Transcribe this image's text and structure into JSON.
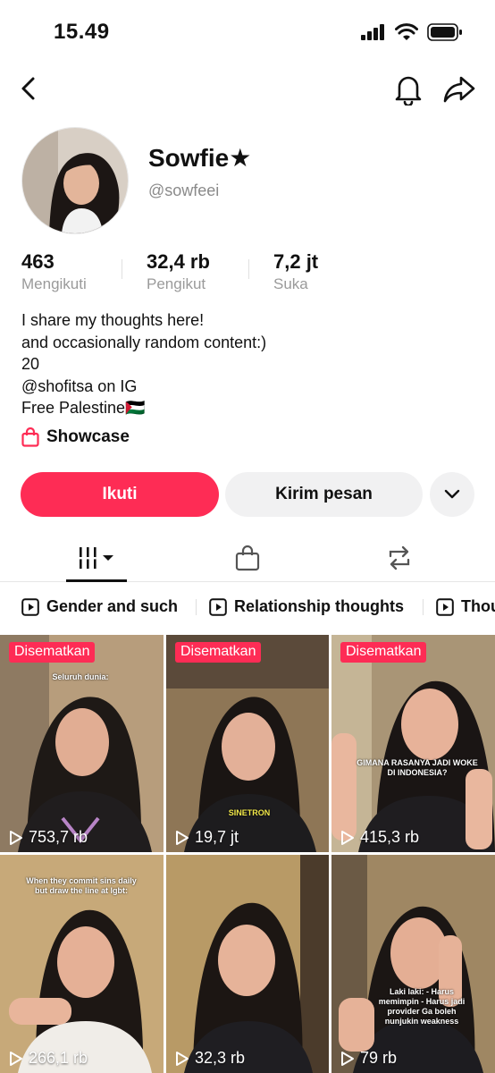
{
  "status_bar": {
    "time": "15.49"
  },
  "profile": {
    "name": "Sowfie★",
    "handle": "@sowfeei",
    "stats": [
      {
        "value": "463",
        "label": "Mengikuti"
      },
      {
        "value": "32,4 rb",
        "label": "Pengikut"
      },
      {
        "value": "7,2 jt",
        "label": "Suka"
      }
    ],
    "bio": [
      "I share my thoughts here!",
      "and occasionally random content:)",
      "20",
      "@shofitsa on IG",
      "Free Palestine🇵🇸"
    ],
    "showcase_label": "Showcase"
  },
  "actions": {
    "follow_label": "Ikuti",
    "message_label": "Kirim pesan"
  },
  "playlists": [
    "Gender and such",
    "Relationship thoughts",
    "Thou"
  ],
  "videos": [
    {
      "pinned_label": "Disematkan",
      "views": "753,7 rb",
      "caption": "Seluruh dunia:"
    },
    {
      "pinned_label": "Disematkan",
      "views": "19,7 jt",
      "caption": "SINETRON"
    },
    {
      "pinned_label": "Disematkan",
      "views": "415,3 rb",
      "caption": "GIMANA RASANYA JADI WOKE DI INDONESIA?"
    },
    {
      "pinned_label": "",
      "views": "266,1 rb",
      "caption": "When they commit sins daily but draw the line at lgbt:"
    },
    {
      "pinned_label": "",
      "views": "32,3 rb",
      "caption": ""
    },
    {
      "pinned_label": "",
      "views": "79 rb",
      "caption": "Laki laki: - Harus memimpin - Harus jadi provider Ga boleh nunjukin weakness"
    }
  ],
  "colors": {
    "accent": "#fe2c55",
    "secondary_button": "#f1f1f2"
  }
}
